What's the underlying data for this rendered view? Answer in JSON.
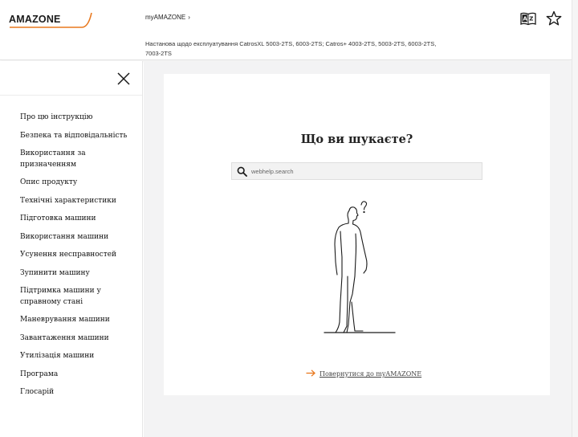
{
  "header": {
    "logo_text": "AMAZONE",
    "breadcrumb": "myAMAZONE",
    "breadcrumb_chevron": "›",
    "manual_title": "Настанова щодо експлуатування CatrosXL 5003-2TS, 6003-2TS; Catros+ 4003-2TS, 5003-2TS, 6003-2TS, 7003-2TS",
    "icons": [
      "language-az-icon",
      "star-icon"
    ]
  },
  "sidebar": {
    "close_icon": "close-icon",
    "items": [
      {
        "label": "Про цю інструкцію"
      },
      {
        "label": "Безпека та відповідальність"
      },
      {
        "label": "Використання за призначенням"
      },
      {
        "label": "Опис продукту"
      },
      {
        "label": "Технічні характеристики"
      },
      {
        "label": "Підготовка машини"
      },
      {
        "label": "Використання машини"
      },
      {
        "label": "Усунення несправностей"
      },
      {
        "label": "Зупинити машину"
      },
      {
        "label": "Підтримка машини у справному стані"
      },
      {
        "label": "Маневрування машини"
      },
      {
        "label": "Завантаження машини"
      },
      {
        "label": "Утилізація машини"
      },
      {
        "label": "Програма"
      },
      {
        "label": "Глосарій"
      }
    ]
  },
  "main": {
    "question": "Що ви шукаєте?",
    "search_placeholder": "webhelp.search",
    "search_value": "",
    "back_link": "Повернутися до myAMAZONE",
    "icons": [
      "search-icon",
      "arrow-right-icon"
    ]
  },
  "colors": {
    "accent": "#e8781e",
    "text": "#1a1a1a",
    "background": "#f3f3f4"
  }
}
